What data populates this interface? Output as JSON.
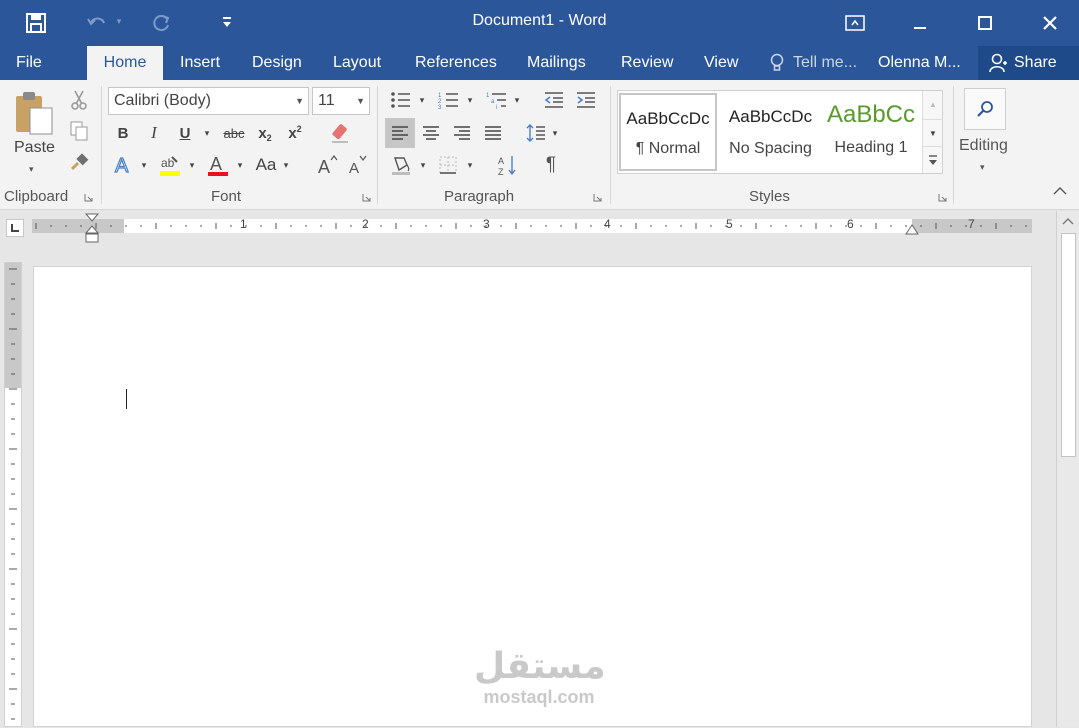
{
  "window": {
    "title": "Document1 - Word",
    "icons": [
      "save-icon",
      "undo-icon",
      "redo-icon",
      "customize-qat-icon",
      "ribbon-display-options-icon",
      "minimize-icon",
      "maximize-icon",
      "close-icon"
    ]
  },
  "tabs": [
    "File",
    "Home",
    "Insert",
    "Design",
    "Layout",
    "References",
    "Mailings",
    "Review",
    "View"
  ],
  "tell_me": "Tell me...",
  "user": "Olenna M...",
  "share": "Share",
  "clipboard": {
    "paste": "Paste",
    "label": "Clipboard"
  },
  "font": {
    "name": "Calibri (Body)",
    "size": "11",
    "label": "Font",
    "change_case": "Aa"
  },
  "paragraph": {
    "label": "Paragraph"
  },
  "styles": {
    "label": "Styles",
    "items": [
      {
        "sample": "AaBbCcDc",
        "name": "¶ Normal",
        "color": "#222222"
      },
      {
        "sample": "AaBbCcDc",
        "name": "No Spacing",
        "color": "#222222"
      },
      {
        "sample": "AaBbCc",
        "name": "Heading 1",
        "color": "#5a9a2c"
      }
    ]
  },
  "editing": {
    "label": "Editing"
  },
  "ruler": {
    "numbers": [
      "1",
      "2",
      "3",
      "4",
      "5",
      "6",
      "7"
    ]
  },
  "watermark": {
    "arabic": "مستقل",
    "latin": "mostaql.com"
  },
  "colors": {
    "accent": "#2b579a",
    "highlight": "#ffff00",
    "font_color": "#e81123"
  }
}
